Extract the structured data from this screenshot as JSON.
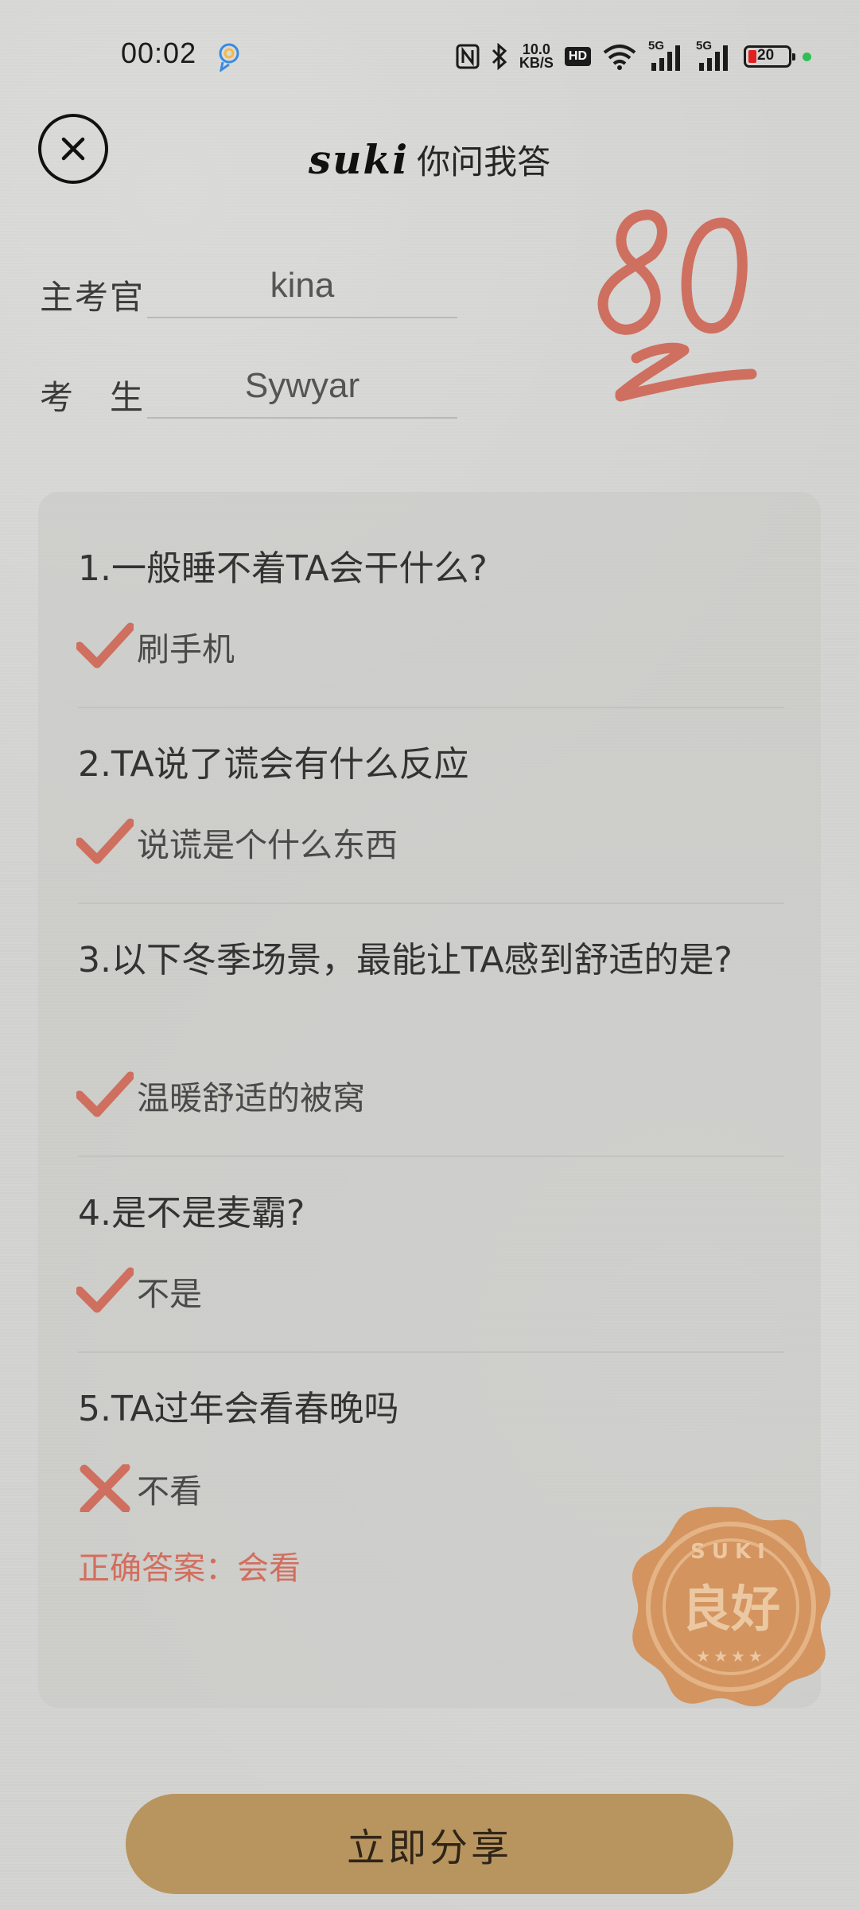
{
  "status_bar": {
    "time": "00:02",
    "net_speed_top": "10.0",
    "net_speed_bottom": "KB/S",
    "hd_label": "HD",
    "sim1_label": "5G",
    "sim2_label": "5G",
    "battery_level": "20"
  },
  "header": {
    "brand": "suki",
    "title": "你问我答"
  },
  "fields": {
    "examiner_label": "主考官",
    "examiner_value": "kina",
    "candidate_label": "考　生",
    "candidate_value": "Sywyar"
  },
  "score": {
    "value": 80,
    "color": "#cf6f5f"
  },
  "questions": [
    {
      "text": "1.一般睡不着TA会干什么?",
      "answer": "刷手机",
      "correct": true
    },
    {
      "text": "2.TA说了谎会有什么反应",
      "answer": "说谎是个什么东西",
      "correct": true
    },
    {
      "text": "3.以下冬季场景，最能让TA感到舒适的是?",
      "answer": "温暖舒适的被窝",
      "correct": true
    },
    {
      "text": "4.是不是麦霸?",
      "answer": "不是",
      "correct": true
    },
    {
      "text": "5.TA过年会看春晚吗",
      "answer": "不看",
      "correct": false
    }
  ],
  "correct_answer_text": "正确答案：会看",
  "stamp": {
    "top_text": "SUKI",
    "center_text": "良好",
    "color": "#d58a4d"
  },
  "share_button_label": "立即分享",
  "colors": {
    "accent_mark": "#cf6f5f",
    "button": "#b8955f",
    "background": "#d3d3d1"
  }
}
